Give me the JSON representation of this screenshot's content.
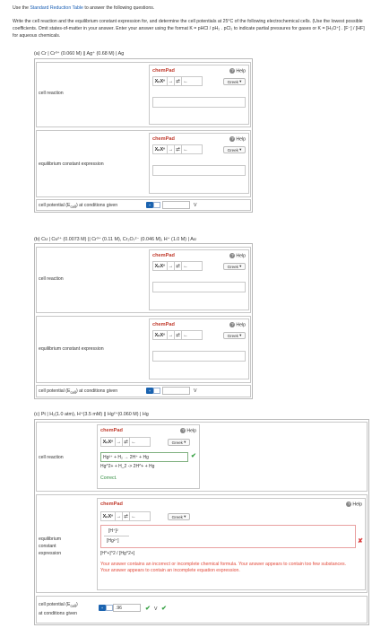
{
  "intro": {
    "prefix": "Use the",
    "link": "Standard Reduction Table",
    "suffix": "to answer the following questions."
  },
  "instructions": "Write the cell reaction and the equilibrium constant expression for, and determine the cell potentials at 25°C of the following electrochemical cells. (Use the lowest possible coefficients. Omit states-of-matter in your answer. Enter your answer using the format K = pHCl / pH₂ . pCl₂ to indicate partial pressures for gases or K = [H₃O⁺] . [F⁻] / [HF] for aqueous chemicals.",
  "labels": {
    "cell_reaction": "cell reaction",
    "equilibrium": "equilibrium constant expression",
    "equilibrium_split": [
      "equilibrium",
      "constant",
      "expression"
    ],
    "potential": "cell potential (E",
    "potential_sub": "cell",
    "potential_suffix": ") at conditions given",
    "potential_c_line2": "at conditions given",
    "unit_v": "V"
  },
  "chempad": {
    "title": "chemPad",
    "help": "Help",
    "greek": "Greek",
    "xx": "XₙXⁿ",
    "arrow": "→",
    "equil": "⇄",
    "back": "←"
  },
  "parts": {
    "a": {
      "header": "(a) Cr | Cr³⁺ (0.060 M) || Ag⁺ (0.68 M) | Ag"
    },
    "b": {
      "header": "(b) Cu | Cu²⁺ (0.0073 M) || Cr³⁺ (0.11 M), Cr₂O₇²⁻ (0.046 M), H⁺ (1.0 M) | Au"
    },
    "c": {
      "header": "(c) Pt | H₂(1.0 atm), H⁺(3.5 mM) || Hg²⁺(0.060 M) | Hg",
      "reaction_line1": "Hg²⁺ + H₂ → 2H⁺ + Hg",
      "reaction_line2": "Hg^2+ + H_2 -> 2H^+ + Hg",
      "correct": "Correct.",
      "eq_line1": "[H⁺]²",
      "eq_line2": "[Hg²⁺]",
      "eq_line3": "[H^+]^2 / [Hg^2+]",
      "error": "Your answer contains an incorrect or incomplete chemical formula. Your answer appears to contain too few substances. Your answer appears to contain an incomplete equation expression.",
      "potential_value": ".96"
    }
  },
  "colors": {
    "link": "#1a5fb4",
    "chempad_title": "#c0392b",
    "correct": "#36a143",
    "error": "#e24a3b",
    "units_icon": "#1a63b0"
  }
}
